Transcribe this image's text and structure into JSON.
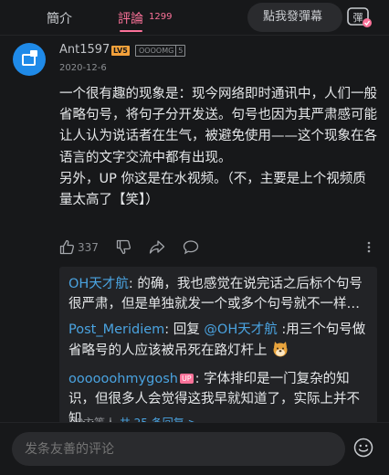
{
  "tabs": {
    "intro": "簡介",
    "comments": "評論",
    "comment_count": "1299"
  },
  "danmaku": {
    "placeholder": "點我發彈幕",
    "button_icon": "danmaku-toggle-icon",
    "button_glyph": "彈"
  },
  "comment": {
    "username": "Ant1597",
    "level": "LV5",
    "fan_badge_name": "OOOOMG",
    "fan_badge_level": "5",
    "date": "2020-12-6",
    "text": "一个很有趣的现象是：现今网络即时通讯中，人们一般省略句号，将句子分开发送。句号也因为其严肃感可能让人认为说话者在生气，被避免使用——这个现象在各语言的文字交流中都有出现。\n另外，UP 你这是在水视频。（不，主要是上个视频质量太高了【笑】）",
    "likes": "337"
  },
  "replies": [
    {
      "name": "OH天才航",
      "sep": ": ",
      "text": "的确，我也感觉在说完话之后标个句号很严肃，但是单独就发一个或多个句号就不一样…"
    },
    {
      "name": "Post_Meridiem",
      "sep": ": ",
      "text_prefix": "回复 ",
      "mention": "@OH天才航",
      "text": " :用三个句号做省略号的人应该被吊死在路灯杆上"
    },
    {
      "name": "oooooohmygosh",
      "badge": "UP",
      "sep": ": ",
      "text": "字体排印是一门复杂的知识，但很多人会觉得这我早就知道了，实际上并不知…"
    }
  ],
  "replies_footer": {
    "prefix": "UP主等人",
    "link": "共 25 条回复 >"
  },
  "bottom": {
    "input_placeholder": "发条友善的评论"
  },
  "colors": {
    "accent": "#fb7299",
    "link": "#4aa3e0",
    "background": "#17181a"
  }
}
